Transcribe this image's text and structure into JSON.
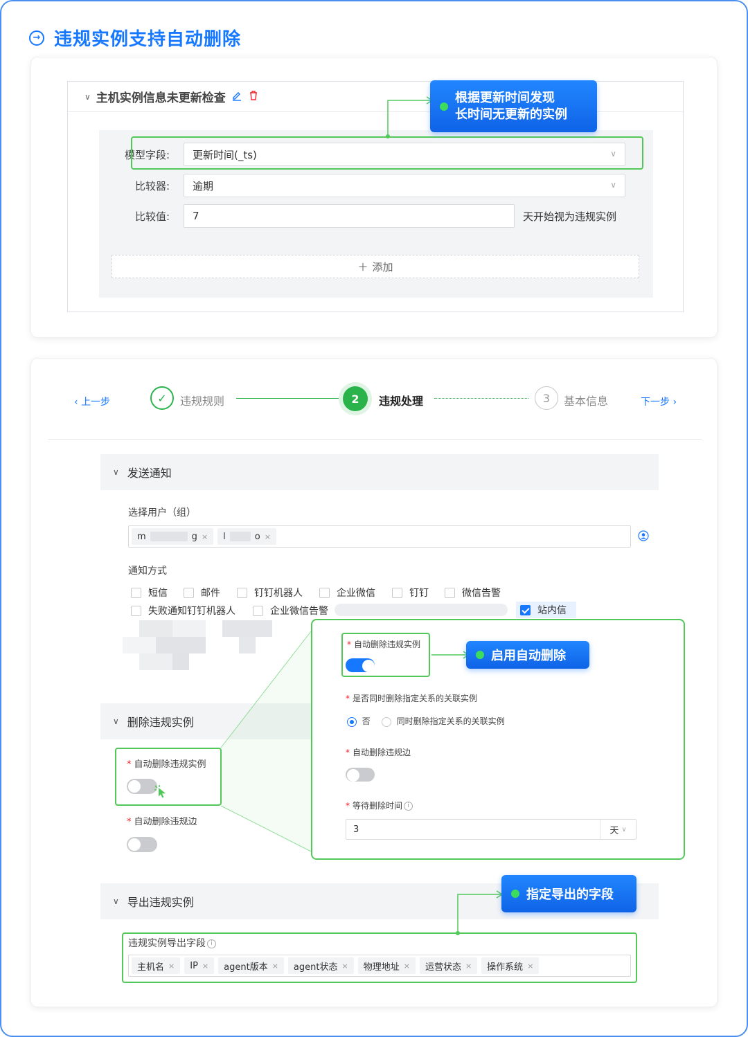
{
  "page": {
    "title": "违规实例支持自动删除"
  },
  "rule_card": {
    "rule_title": "主机实例信息未更新检查",
    "fields": [
      {
        "label": "模型字段:",
        "value": "更新时间(_ts)",
        "dropdown": true
      },
      {
        "label": "比较器:",
        "value": "逾期",
        "dropdown": true
      },
      {
        "label": "比较值:",
        "value": "7",
        "suffix": "天开始视为违规实例"
      }
    ],
    "add_label": "添加",
    "callout": {
      "line1": "根据更新时间发现",
      "line2": "长时间无更新的实例"
    }
  },
  "steps": {
    "prev": "上一步",
    "next": "下一步",
    "items": [
      {
        "label": "违规规则",
        "state": "done",
        "mark": "✓"
      },
      {
        "label": "违规处理",
        "state": "active",
        "mark": "2"
      },
      {
        "label": "基本信息",
        "state": "todo",
        "mark": "3"
      }
    ]
  },
  "notify": {
    "section_title": "发送通知",
    "users_label": "选择用户（组）",
    "user_tags": [
      {
        "prefix": "m",
        "suffix": "g"
      },
      {
        "prefix": "l",
        "suffix": "o"
      }
    ],
    "methods_label": "通知方式",
    "methods_row1": [
      "短信",
      "邮件",
      "钉钉机器人",
      "企业微信",
      "钉钉",
      "微信告警"
    ],
    "methods_row2": [
      "失败通知钉钉机器人",
      "企业微信告警"
    ],
    "checked_method": "站内信"
  },
  "delete": {
    "section_title": "删除违规实例",
    "auto_delete_label": "自动删除违规实例",
    "auto_delete_edge_label": "自动删除违规边",
    "panel": {
      "auto_delete_label": "自动删除违规实例",
      "auto_delete_on": true,
      "related_label": "是否同时删除指定关系的关联实例",
      "radio_no": "否",
      "radio_yes": "同时删除指定关系的关联实例",
      "edge_label": "自动删除违规边",
      "edge_on": false,
      "wait_label": "等待删除时间",
      "wait_value": "3",
      "wait_unit": "天"
    },
    "callout": "启用自动删除"
  },
  "export": {
    "section_title": "导出违规实例",
    "fields_label": "违规实例导出字段",
    "fields": [
      "主机名",
      "IP",
      "agent版本",
      "agent状态",
      "物理地址",
      "运营状态",
      "操作系统"
    ],
    "callout": "指定导出的字段"
  },
  "colors": {
    "accent": "#1677ff",
    "highlight": "#52c85a",
    "step_active": "#2ab34b"
  }
}
